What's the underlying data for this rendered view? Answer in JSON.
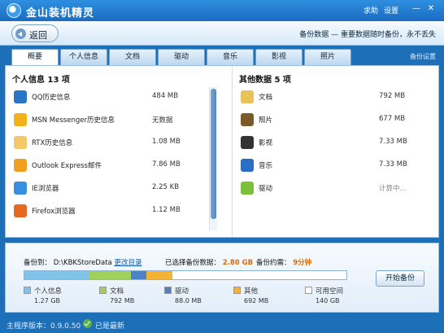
{
  "app": {
    "title": "金山装机精灵",
    "links": [
      "求助",
      "设置"
    ],
    "window_controls": [
      "minimize-icon",
      "close-icon"
    ]
  },
  "header": {
    "back_label": "返回",
    "hint": "备份数据 — 重要数据随时备份，永不丢失"
  },
  "tabs": [
    {
      "label": "概要",
      "active": true
    },
    {
      "label": "个人信息",
      "active": false
    },
    {
      "label": "文档",
      "active": false
    },
    {
      "label": "驱动",
      "active": false
    },
    {
      "label": "音乐",
      "active": false
    },
    {
      "label": "影视",
      "active": false
    },
    {
      "label": "照片",
      "active": false
    }
  ],
  "backup_settings": "备份设置",
  "personal": {
    "title": "个人信息 13 项",
    "items": [
      {
        "name": "QQ历史信息",
        "size": "484 MB",
        "icon": "qq-icon",
        "color": "#2a76c4"
      },
      {
        "name": "MSN Messenger历史信息",
        "size": "无数据",
        "icon": "msn-icon",
        "color": "#f1b21a"
      },
      {
        "name": "RTX历史信息",
        "size": "1.08 MB",
        "icon": "folder-icon",
        "color": "#f2c86a"
      },
      {
        "name": "Outlook Express邮件",
        "size": "7.86 MB",
        "icon": "outlook-icon",
        "color": "#f0a020"
      },
      {
        "name": "IE浏览器",
        "size": "2.25 KB",
        "icon": "ie-icon",
        "color": "#3a8ee0"
      },
      {
        "name": "Firefox浏览器",
        "size": "1.12 MB",
        "icon": "firefox-icon",
        "color": "#e46a22"
      }
    ]
  },
  "other": {
    "title": "其他数据 5 项",
    "items": [
      {
        "name": "文档",
        "size": "792 MB",
        "icon": "document-icon",
        "color": "#e9c25a"
      },
      {
        "name": "照片",
        "size": "677 MB",
        "icon": "photo-icon",
        "color": "#7a5a2a"
      },
      {
        "name": "影视",
        "size": "7.33 MB",
        "icon": "film-icon",
        "color": "#333333"
      },
      {
        "name": "音乐",
        "size": "7.33 MB",
        "icon": "music-icon",
        "color": "#2a6fc4"
      },
      {
        "name": "驱动",
        "size": "计算中...",
        "icon": "driver-icon",
        "color": "#7cbf3a"
      }
    ]
  },
  "storage": {
    "backup_to_label": "备份到：",
    "backup_path": "D:\\KBKStoreData",
    "change_dir": "更改目录",
    "selected_label": "已选择备份数据：",
    "selected_value": "2.80 GB",
    "eta_label": "备份约需：",
    "eta_value": "9分钟",
    "start_button": "开始备份",
    "legend": [
      {
        "name": "个人信息",
        "value": "1.27 GB",
        "color": "#7fc3e8"
      },
      {
        "name": "文档",
        "value": "792 MB",
        "color": "#9ed05a"
      },
      {
        "name": "驱动",
        "value": "88.0 MB",
        "color": "#4a84c6"
      },
      {
        "name": "其他",
        "value": "692 MB",
        "color": "#f3b334"
      },
      {
        "name": "可用空间",
        "value": "140 GB",
        "color": "#ffffff"
      }
    ],
    "bar_fractions": [
      0.2,
      0.13,
      0.05,
      0.08
    ]
  },
  "footer": {
    "version": "主程序版本：0.9.0.50",
    "status": "已是最新"
  }
}
